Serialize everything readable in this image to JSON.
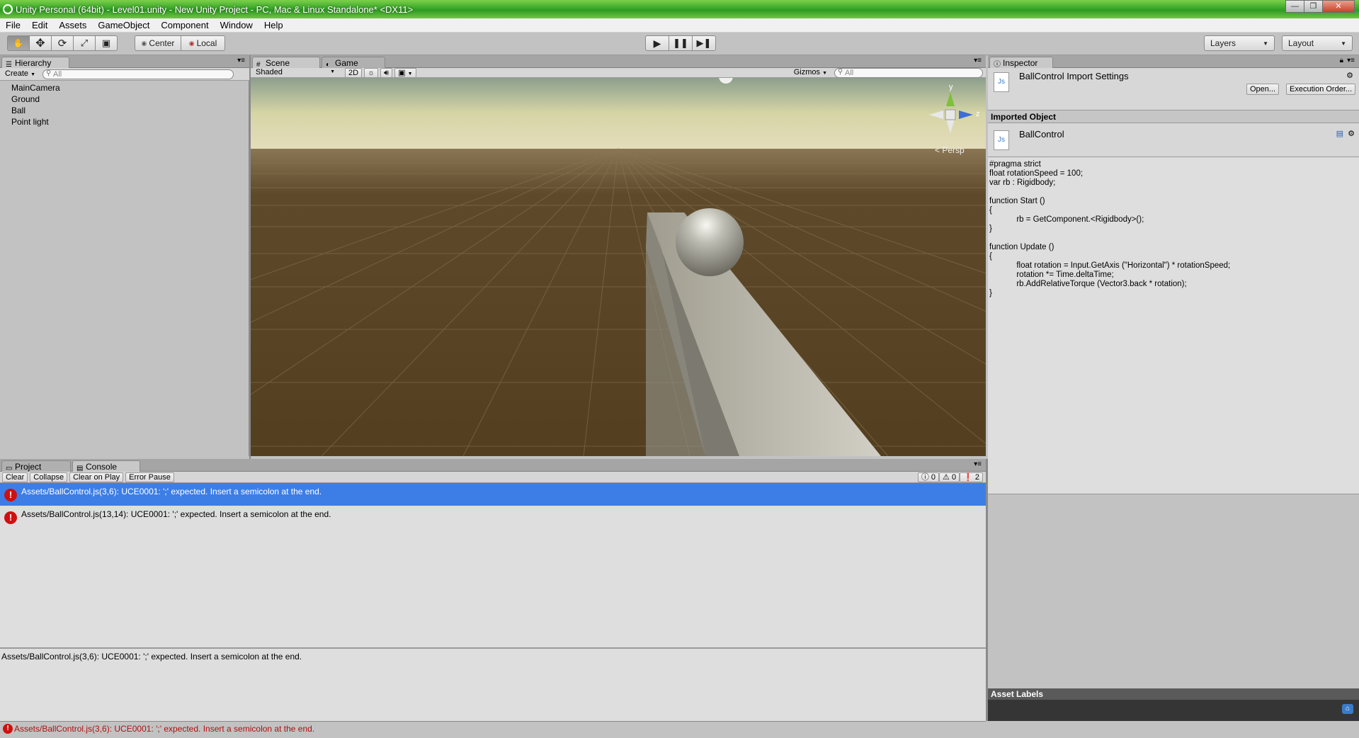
{
  "window": {
    "title": "Unity Personal (64bit) - Level01.unity - New Unity Project - PC, Mac & Linux Standalone* <DX11>",
    "minimize": "—",
    "maximize": "❐",
    "close": "✕"
  },
  "menu": [
    "File",
    "Edit",
    "Assets",
    "GameObject",
    "Component",
    "Window",
    "Help"
  ],
  "toolbar": {
    "pivot": "Center",
    "space": "Local",
    "layers": "Layers",
    "layout": "Layout"
  },
  "hierarchy": {
    "tab": "Hierarchy",
    "create": "Create",
    "search_placeholder": "All",
    "items": [
      "MainCamera",
      "Ground",
      "Ball",
      "Point light"
    ]
  },
  "scene": {
    "tabs": [
      "Scene",
      "Game"
    ],
    "shading": "Shaded",
    "mode_2d": "2D",
    "gizmos": "Gizmos",
    "search_placeholder": "All",
    "persp": "Persp",
    "axis_y": "y",
    "axis_z": "z"
  },
  "inspector": {
    "tab": "Inspector",
    "header_title": "BallControl Import Settings",
    "open_button": "Open...",
    "exec_order_button": "Execution Order...",
    "imported_object_label": "Imported Object",
    "object_name": "BallControl",
    "asset_labels": "Asset Labels",
    "file_icon": "Js",
    "code": [
      "#pragma strict",
      "",
      "float rotationSpeed = 100;",
      "var rb : Rigidbody;",
      "",
      "function Start ()",
      "{",
      "            rb = GetComponent.<Rigidbody>();",
      "}",
      "",
      "function Update ()",
      "{",
      "            float rotation = Input.GetAxis (\"Horizontal\") * rotationSpeed;",
      "            rotation *= Time.deltaTime;",
      "            rb.AddRelativeTorque (Vector3.back * rotation);",
      "}"
    ]
  },
  "console": {
    "tabs": [
      "Project",
      "Console"
    ],
    "buttons": [
      "Clear",
      "Collapse",
      "Clear on Play",
      "Error Pause"
    ],
    "count_info": "0",
    "count_warn": "0",
    "count_error": "2",
    "messages": [
      "Assets/BallControl.js(3,6): UCE0001: ';' expected. Insert a semicolon at the end.",
      "Assets/BallControl.js(13,14): UCE0001: ';' expected. Insert a semicolon at the end."
    ],
    "detail": "Assets/BallControl.js(3,6): UCE0001: ';' expected. Insert a semicolon at the end."
  },
  "status": {
    "message": "Assets/BallControl.js(3,6): UCE0001: ';' expected. Insert a semicolon at the end."
  },
  "colors": {
    "selection": "#3d7ee6",
    "error": "#d01010"
  }
}
